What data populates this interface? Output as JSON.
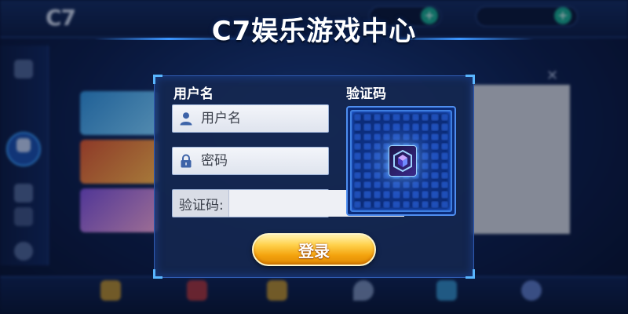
{
  "title": "C7娱乐游戏中心",
  "background": {
    "logo": "C7",
    "colors": {
      "accent": "#3c96ff",
      "plus_button": "#17a58b",
      "login_button": "#f3a20d"
    }
  },
  "login": {
    "username_label": "用户名",
    "username_placeholder": "用户名",
    "password_placeholder": "密码",
    "captcha_label": "验证码",
    "captcha_field_prefix": "验证码:",
    "captcha_value": "",
    "submit_label": "登录",
    "icons": {
      "username": "user-icon",
      "password": "lock-icon",
      "captcha": "captcha-image"
    }
  }
}
